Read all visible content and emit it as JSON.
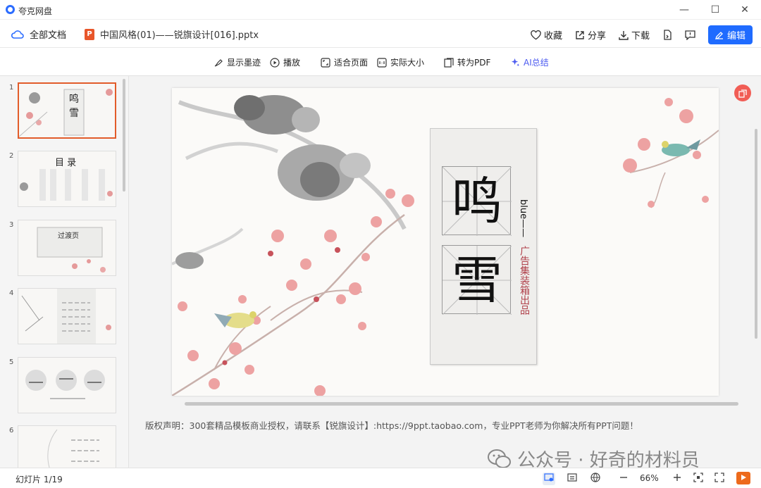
{
  "app": {
    "title": "夸克网盘",
    "controls": [
      "—",
      "☐",
      "✕"
    ]
  },
  "docbar": {
    "all_docs": "全部文档",
    "file_name": "中国风格(01)——锐旗设计[016].pptx",
    "ppt_badge": "P",
    "actions": {
      "favorite": "收藏",
      "share": "分享",
      "download": "下载",
      "edit": "编辑"
    }
  },
  "toolbar": {
    "show_ink": "显示墨迹",
    "play": "播放",
    "fit_page": "适合页面",
    "actual_size": "实际大小",
    "to_pdf": "转为PDF",
    "ai_summary": "AI总结"
  },
  "sidebar": {
    "thumbnails": [
      {
        "num": "1",
        "text": "鸣 雪"
      },
      {
        "num": "2",
        "text": "目 录"
      },
      {
        "num": "3",
        "text": "过渡页"
      },
      {
        "num": "4",
        "text": ""
      },
      {
        "num": "5",
        "text": ""
      },
      {
        "num": "6",
        "text": ""
      }
    ]
  },
  "slide": {
    "char1": "鸣",
    "char2": "雪",
    "side_text": "blue——",
    "tagline": "广告集装箱出品"
  },
  "notes": "版权声明：300套精品模板商业授权，请联系【锐旗设计】:https://9ppt.taobao.com，专业PPT老师为你解决所有PPT问题！",
  "watermark": "公众号 · 好奇的材料员",
  "status": {
    "slide_count": "幻灯片 1/19",
    "zoom": "66%"
  },
  "colors": {
    "accent": "#1f6bff",
    "active_thumb": "#e25c2a",
    "ai": "#4c5bf0",
    "play": "#ed6a1c"
  }
}
